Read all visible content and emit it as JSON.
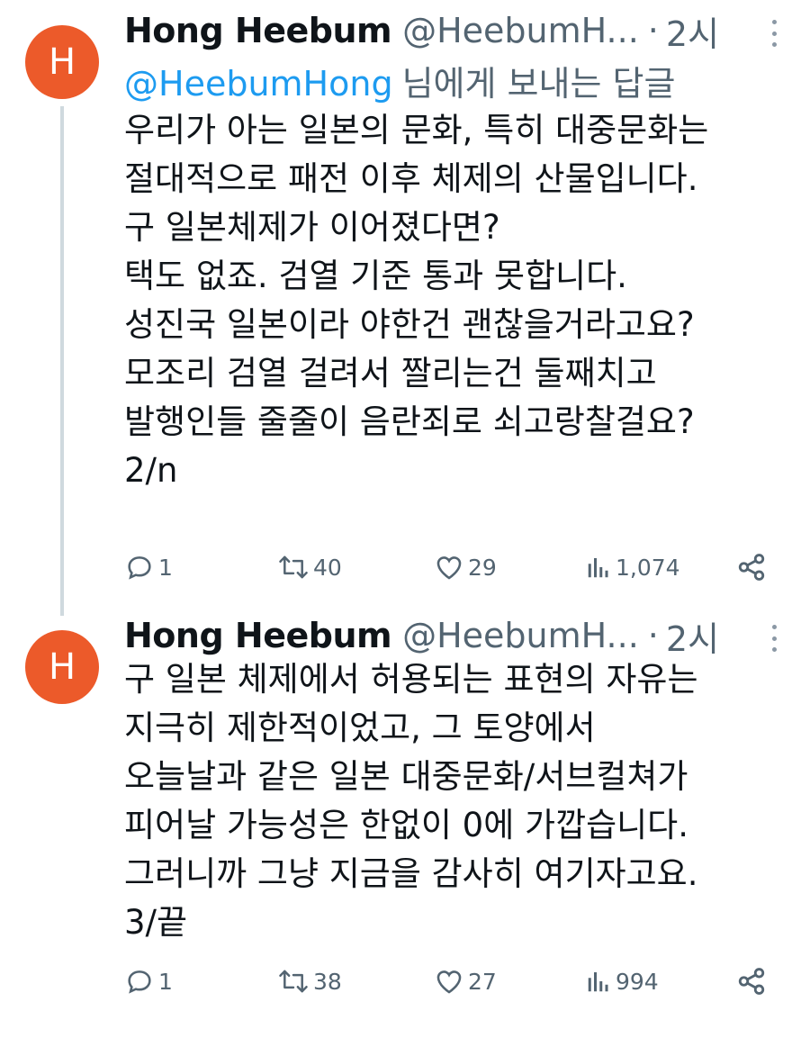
{
  "colors": {
    "avatar_bg": "#ec5a2a",
    "mention": "#1d9bf0",
    "muted": "#536471",
    "thread_line": "#cfd9de"
  },
  "tweets": [
    {
      "avatar_letter": "H",
      "name": "Hong Heebum",
      "handle": "@HeebumH...",
      "dot": "·",
      "time": "2시",
      "reply_to": {
        "mention": "@HeebumHong",
        "rest": "님에게 보내는 답글"
      },
      "lines": [
        "우리가 아는 일본의 문화, 특히 대중문화는",
        "절대적으로 패전 이후 체제의 산물입니다.",
        "구 일본체제가 이어졌다면?",
        "택도 없죠. 검열 기준 통과 못합니다.",
        "성진국 일본이라 야한건 괜찮을거라고요?",
        "모조리 검열 걸려서 짤리는건 둘째치고",
        "발행인들 줄줄이 음란죄로 쇠고랑찰걸요?",
        "2/n"
      ],
      "stats": {
        "replies": "1",
        "retweets": "40",
        "likes": "29",
        "views": "1,074"
      }
    },
    {
      "avatar_letter": "H",
      "name": "Hong Heebum",
      "handle": "@HeebumH...",
      "dot": "·",
      "time": "2시",
      "lines": [
        "구 일본 체제에서 허용되는 표현의 자유는",
        "지극히 제한적이었고, 그 토양에서",
        "오늘날과 같은 일본 대중문화/서브컬쳐가",
        "피어날 가능성은 한없이 0에 가깝습니다.",
        "그러니까 그냥 지금을 감사히 여기자고요.",
        "3/끝"
      ],
      "stats": {
        "replies": "1",
        "retweets": "38",
        "likes": "27",
        "views": "994"
      }
    }
  ]
}
